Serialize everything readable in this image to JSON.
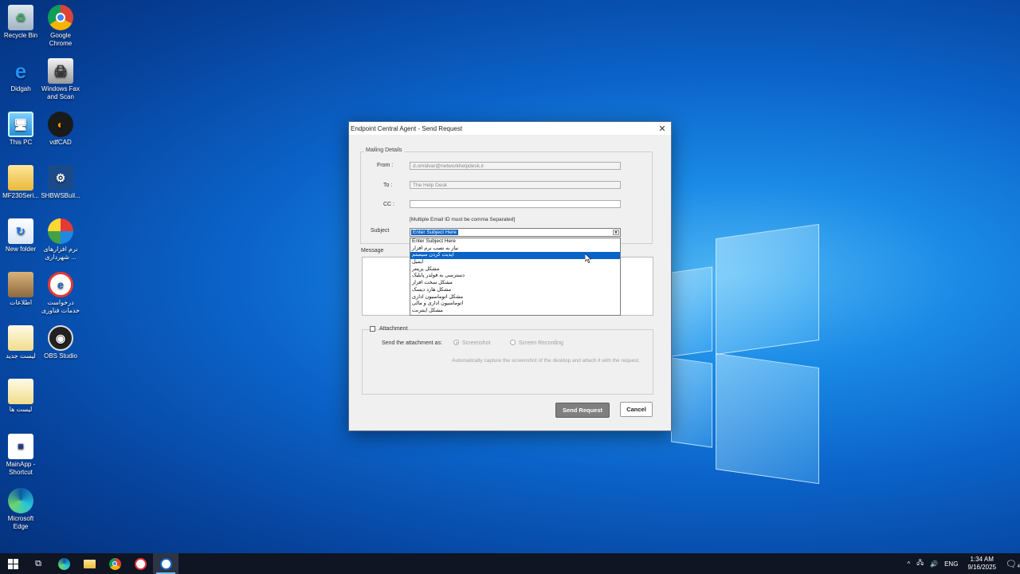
{
  "desktop": {
    "icons": [
      {
        "label": "Recycle Bin"
      },
      {
        "label": "Google Chrome"
      },
      {
        "label": "Didgah"
      },
      {
        "label": "Windows Fax and Scan"
      },
      {
        "label": "This PC"
      },
      {
        "label": "vdfCAD"
      },
      {
        "label": "MF230Seri..."
      },
      {
        "label": "SHBWSBuil..."
      },
      {
        "label": "New folder"
      },
      {
        "label": "نرم افزارهای ... شهرداری"
      },
      {
        "label": "اطلاعات"
      },
      {
        "label": "درخواست خدمات فناوری"
      },
      {
        "label": "لیست جدید"
      },
      {
        "label": "OBS Studio"
      },
      {
        "label": "لیست ها"
      },
      {
        "label": "MainApp - Shortcut"
      },
      {
        "label": "Microsoft Edge"
      }
    ]
  },
  "dialog": {
    "title": "Endpoint Central Agent - Send Request",
    "mailing_group": "Mailing Details",
    "from_label": "From :",
    "from_value": "d.omidvar@networkhelpdesk.ir",
    "to_label": "To :",
    "to_value": "The Help Desk",
    "cc_label": "CC :",
    "cc_value": "",
    "cc_hint": "[Multiple Email ID must be comma Separated]",
    "subject_label": "Subject",
    "subject_value": "Enter Subject Here",
    "message_label": "Message",
    "subject_options": [
      "Enter Subject Here",
      "نیاز به نصب نرم افزار",
      "آپدیت کردن سیستم",
      "ایمیل",
      "مشکل پرینتر",
      "دسترسی به فولدر پابلیک",
      "مشکل سخت افزار",
      "مشکل هارد دیسک",
      "مشکل اتوماسیون اداری",
      "اتوماسیون اداری و مالی",
      "مشکل اینترنت"
    ],
    "selected_option_index": 2,
    "attachment_label": "Attachment",
    "send_as_label": "Send the attachment as:",
    "screenshot_label": "Screenshot",
    "recording_label": "Screen Recording",
    "attachment_hint": "Automatically capture the screenshot of the desktop and attach it with the request.",
    "send_button": "Send Request",
    "cancel_button": "Cancel"
  },
  "taskbar": {
    "language": "ENG",
    "time": "1:34 AM",
    "date": "9/16/2025",
    "notification_count": "4"
  }
}
